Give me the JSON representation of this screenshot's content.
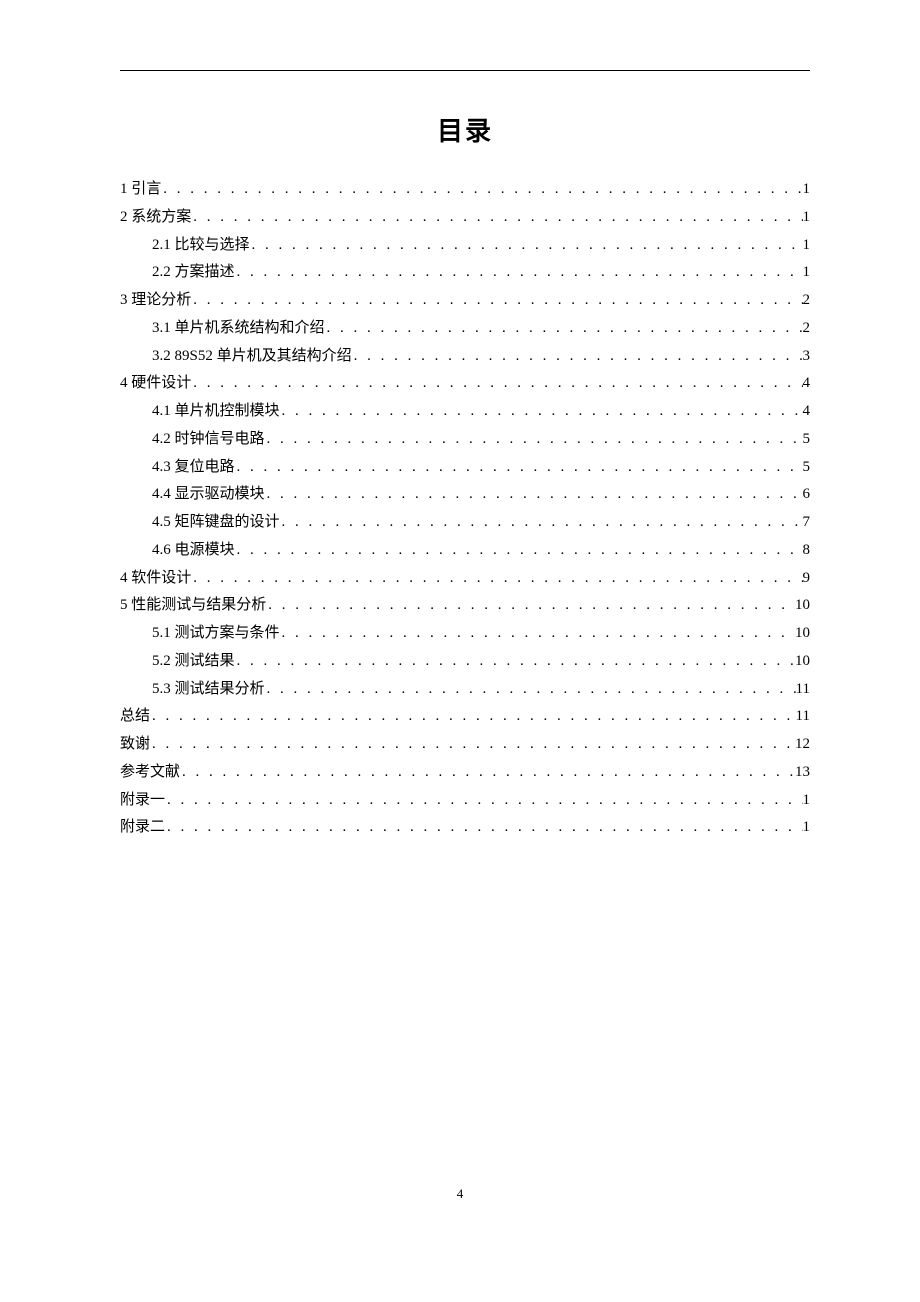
{
  "title": "目录",
  "page_number": "4",
  "toc": [
    {
      "level": 1,
      "label": "1 引言",
      "page": "1"
    },
    {
      "level": 1,
      "label": "2 系统方案",
      "page": "1"
    },
    {
      "level": 2,
      "label": "2.1 比较与选择",
      "page": "1"
    },
    {
      "level": 2,
      "label": "2.2 方案描述",
      "page": "1"
    },
    {
      "level": 1,
      "label": "3 理论分析",
      "page": "2"
    },
    {
      "level": 2,
      "label": "3.1 单片机系统结构和介绍",
      "page": "2"
    },
    {
      "level": 2,
      "label": "3.2 89S52 单片机及其结构介绍",
      "page": "3"
    },
    {
      "level": 1,
      "label": "4 硬件设计",
      "page": "4"
    },
    {
      "level": 2,
      "label": "4.1 单片机控制模块",
      "page": "4"
    },
    {
      "level": 2,
      "label": "4.2 时钟信号电路",
      "page": "5"
    },
    {
      "level": 2,
      "label": "4.3 复位电路",
      "page": "5"
    },
    {
      "level": 2,
      "label": "4.4 显示驱动模块",
      "page": "6"
    },
    {
      "level": 2,
      "label": "4.5 矩阵键盘的设计",
      "page": "7"
    },
    {
      "level": 2,
      "label": "4.6 电源模块",
      "page": "8"
    },
    {
      "level": 1,
      "label": "4 软件设计",
      "page": "9"
    },
    {
      "level": 1,
      "label": "5 性能测试与结果分析",
      "page": "10"
    },
    {
      "level": 2,
      "label": "5.1 测试方案与条件",
      "page": "10"
    },
    {
      "level": 2,
      "label": "5.2 测试结果",
      "page": "10"
    },
    {
      "level": 2,
      "label": "5.3 测试结果分析",
      "page": "11"
    },
    {
      "level": 1,
      "label": "总结",
      "page": "11"
    },
    {
      "level": 1,
      "label": "致谢",
      "page": "12"
    },
    {
      "level": 1,
      "label": "参考文献",
      "page": "13"
    },
    {
      "level": 1,
      "label": "附录一",
      "page": "1"
    },
    {
      "level": 1,
      "label": "附录二",
      "page": "1"
    }
  ]
}
